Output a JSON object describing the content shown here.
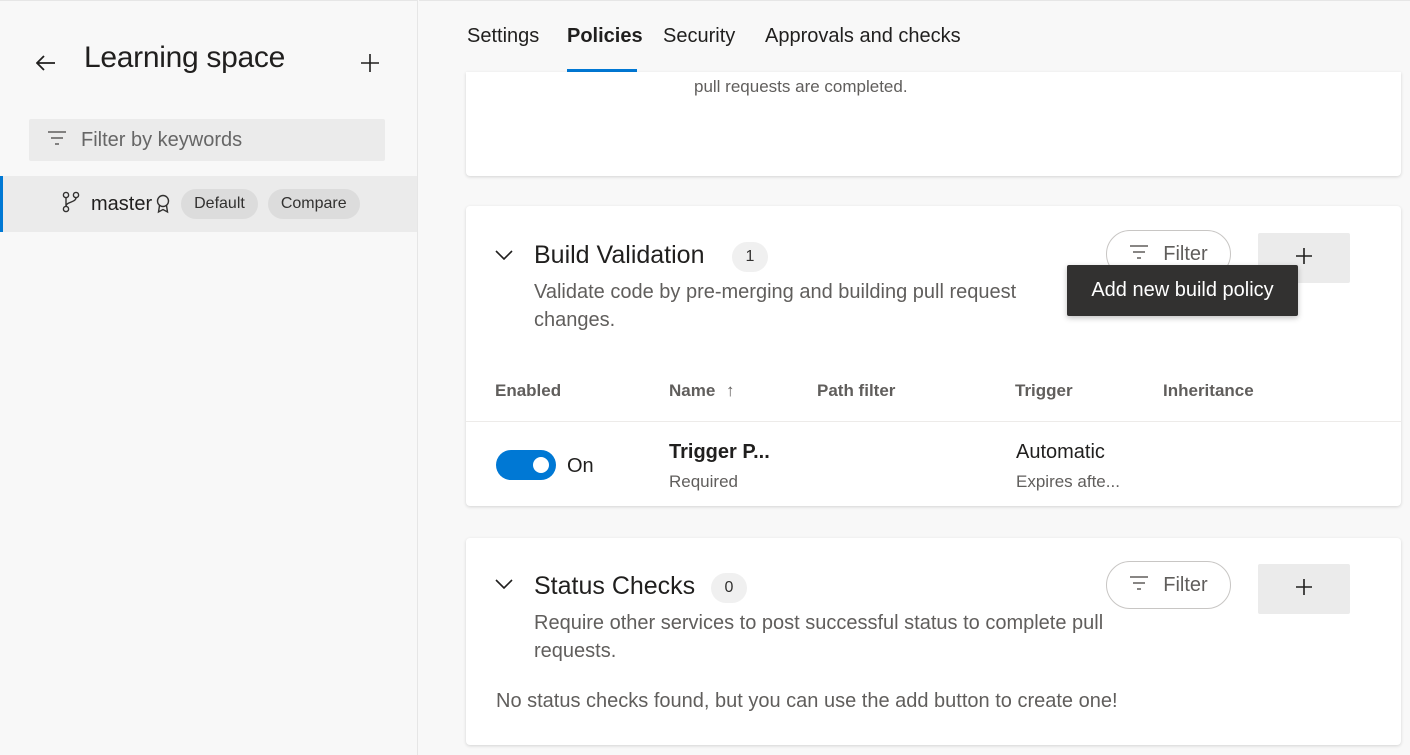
{
  "sidebar": {
    "title": "Learning space",
    "filter_placeholder": "Filter by keywords",
    "branch": {
      "name": "master",
      "badges": [
        "Default",
        "Compare"
      ]
    }
  },
  "tabs": [
    "Settings",
    "Policies",
    "Security",
    "Approvals and checks"
  ],
  "active_tab": "Policies",
  "top_card": {
    "partial_text": "pull requests are completed."
  },
  "build_validation": {
    "title": "Build Validation",
    "count": "1",
    "description": "Validate code by pre-merging and building pull request changes.",
    "filter_label": "Filter",
    "add_tooltip": "Add new build policy",
    "columns": [
      "Enabled",
      "Name",
      "Path filter",
      "Trigger",
      "Inheritance"
    ],
    "sort_indicator": "↑",
    "rows": [
      {
        "enabled_label": "On",
        "enabled": true,
        "name": "Trigger P...",
        "name_sub": "Required",
        "path_filter": "",
        "trigger": "Automatic",
        "trigger_sub": "Expires afte...",
        "inheritance": ""
      }
    ]
  },
  "status_checks": {
    "title": "Status Checks",
    "count": "0",
    "description": "Require other services to post successful status to complete pull requests.",
    "filter_label": "Filter",
    "empty_message": "No status checks found, but you can use the add button to create one!"
  },
  "colors": {
    "accent": "#0078d4",
    "tooltip_bg": "#323130"
  }
}
